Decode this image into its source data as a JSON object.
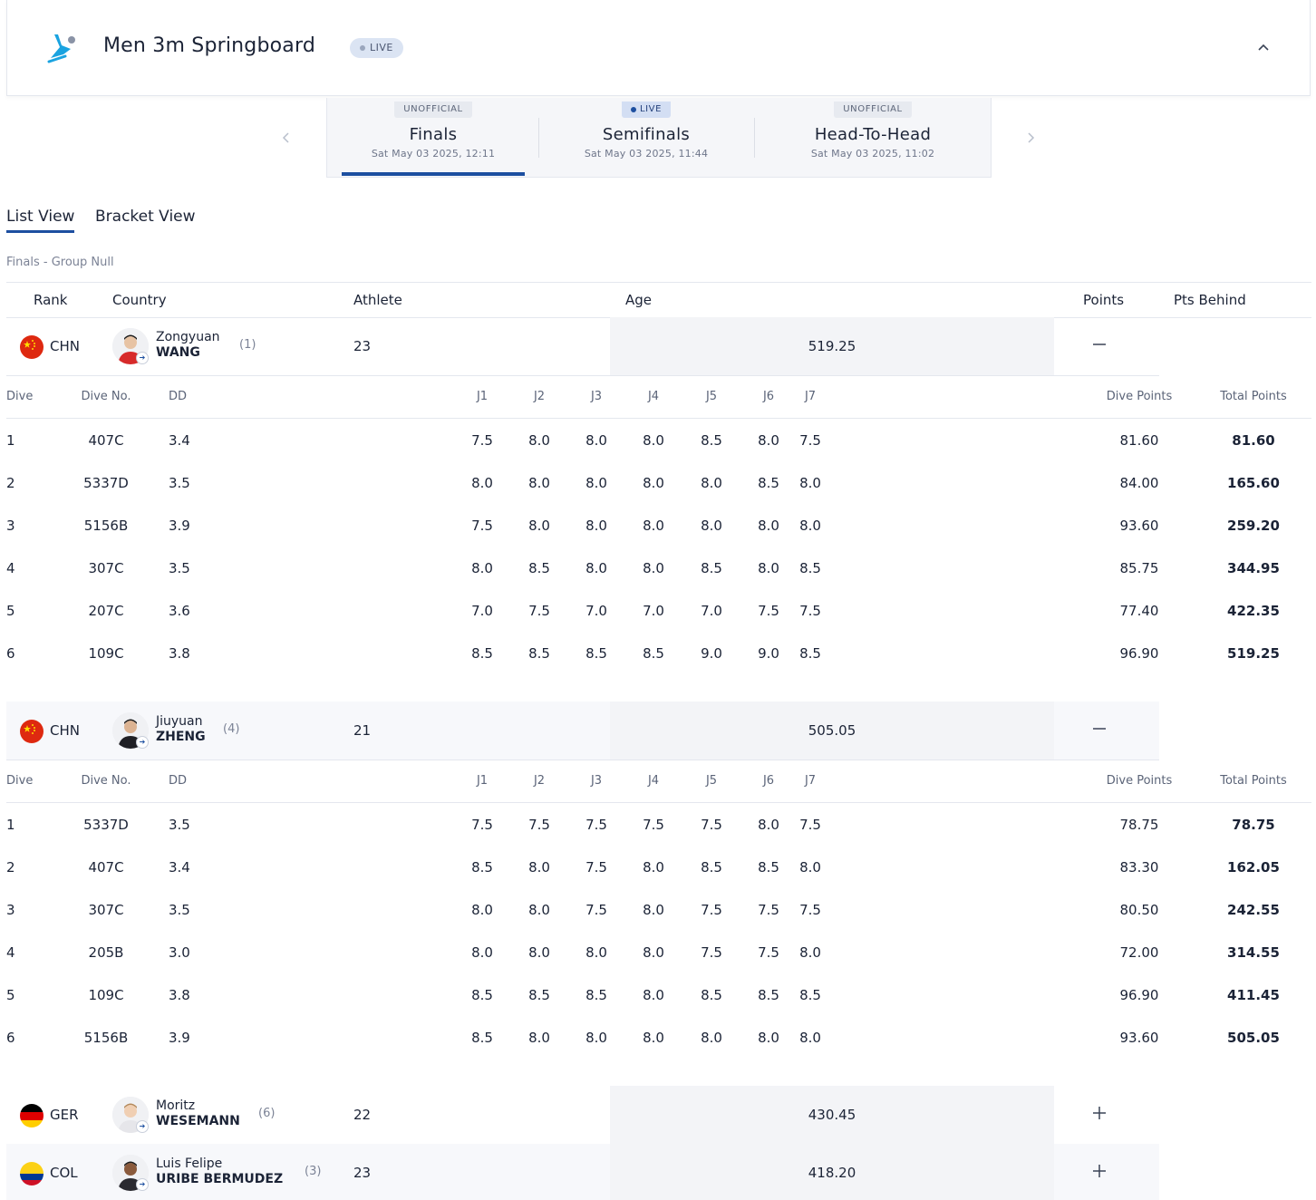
{
  "event": {
    "title": "Men 3m Springboard",
    "live_label": "LIVE"
  },
  "colors": {
    "accent": "#1d4fa0",
    "icon_blue": "#1aa3e0",
    "live_badge_bg": "#dbe4f3"
  },
  "phases": [
    {
      "status": "UNOFFICIAL",
      "name": "Finals",
      "date": "Sat May 03 2025, 12:11",
      "selected": true
    },
    {
      "status": "LIVE",
      "name": "Semifinals",
      "date": "Sat May 03 2025, 11:44",
      "selected": false
    },
    {
      "status": "UNOFFICIAL",
      "name": "Head-To-Head",
      "date": "Sat May 03 2025, 11:02",
      "selected": false
    }
  ],
  "view_tabs": {
    "list": "List View",
    "bracket": "Bracket View",
    "active": "list"
  },
  "group_label": "Finals - Group Null",
  "table_headers": {
    "rank": "Rank",
    "country": "Country",
    "athlete": "Athlete",
    "age": "Age",
    "points": "Points",
    "pts_behind": "Pts Behind"
  },
  "dive_headers": {
    "dive": "Dive",
    "dive_no": "Dive No.",
    "dd": "DD",
    "judges": [
      "J1",
      "J2",
      "J3",
      "J4",
      "J5",
      "J6",
      "J7"
    ],
    "dive_points": "Dive Points",
    "total_points": "Total Points"
  },
  "athletes": [
    {
      "noc": "CHN",
      "flag": "china-flag",
      "first": "Zongyuan",
      "last": "WANG",
      "seed": "(1)",
      "age": "23",
      "points": "519.25",
      "expanded": true,
      "dives": [
        {
          "dive": "1",
          "no": "407C",
          "dd": "3.4",
          "j": [
            "7.5",
            "8.0",
            "8.0",
            "8.0",
            "8.5",
            "8.0",
            "7.5"
          ],
          "dp": "81.60",
          "tp": "81.60"
        },
        {
          "dive": "2",
          "no": "5337D",
          "dd": "3.5",
          "j": [
            "8.0",
            "8.0",
            "8.0",
            "8.0",
            "8.0",
            "8.5",
            "8.0"
          ],
          "dp": "84.00",
          "tp": "165.60"
        },
        {
          "dive": "3",
          "no": "5156B",
          "dd": "3.9",
          "j": [
            "7.5",
            "8.0",
            "8.0",
            "8.0",
            "8.0",
            "8.0",
            "8.0"
          ],
          "dp": "93.60",
          "tp": "259.20"
        },
        {
          "dive": "4",
          "no": "307C",
          "dd": "3.5",
          "j": [
            "8.0",
            "8.5",
            "8.0",
            "8.0",
            "8.5",
            "8.0",
            "8.5"
          ],
          "dp": "85.75",
          "tp": "344.95"
        },
        {
          "dive": "5",
          "no": "207C",
          "dd": "3.6",
          "j": [
            "7.0",
            "7.5",
            "7.0",
            "7.0",
            "7.0",
            "7.5",
            "7.5"
          ],
          "dp": "77.40",
          "tp": "422.35"
        },
        {
          "dive": "6",
          "no": "109C",
          "dd": "3.8",
          "j": [
            "8.5",
            "8.5",
            "8.5",
            "8.5",
            "9.0",
            "9.0",
            "8.5"
          ],
          "dp": "96.90",
          "tp": "519.25"
        }
      ]
    },
    {
      "noc": "CHN",
      "flag": "china-flag",
      "first": "Jiuyuan",
      "last": "ZHENG",
      "seed": "(4)",
      "age": "21",
      "points": "505.05",
      "expanded": true,
      "dives": [
        {
          "dive": "1",
          "no": "5337D",
          "dd": "3.5",
          "j": [
            "7.5",
            "7.5",
            "7.5",
            "7.5",
            "7.5",
            "8.0",
            "7.5"
          ],
          "dp": "78.75",
          "tp": "78.75"
        },
        {
          "dive": "2",
          "no": "407C",
          "dd": "3.4",
          "j": [
            "8.5",
            "8.0",
            "7.5",
            "8.0",
            "8.5",
            "8.5",
            "8.0"
          ],
          "dp": "83.30",
          "tp": "162.05"
        },
        {
          "dive": "3",
          "no": "307C",
          "dd": "3.5",
          "j": [
            "8.0",
            "8.0",
            "7.5",
            "8.0",
            "7.5",
            "7.5",
            "7.5"
          ],
          "dp": "80.50",
          "tp": "242.55"
        },
        {
          "dive": "4",
          "no": "205B",
          "dd": "3.0",
          "j": [
            "8.0",
            "8.0",
            "8.0",
            "8.0",
            "7.5",
            "7.5",
            "8.0"
          ],
          "dp": "72.00",
          "tp": "314.55"
        },
        {
          "dive": "5",
          "no": "109C",
          "dd": "3.8",
          "j": [
            "8.5",
            "8.5",
            "8.5",
            "8.0",
            "8.5",
            "8.5",
            "8.5"
          ],
          "dp": "96.90",
          "tp": "411.45"
        },
        {
          "dive": "6",
          "no": "5156B",
          "dd": "3.9",
          "j": [
            "8.5",
            "8.0",
            "8.0",
            "8.0",
            "8.0",
            "8.0",
            "8.0"
          ],
          "dp": "93.60",
          "tp": "505.05"
        }
      ]
    },
    {
      "noc": "GER",
      "flag": "germany-flag",
      "first": "Moritz",
      "last": "WESEMANN",
      "seed": "(6)",
      "age": "22",
      "points": "430.45",
      "expanded": false
    },
    {
      "noc": "COL",
      "flag": "colombia-flag",
      "first": "Luis Felipe",
      "last": "URIBE BERMUDEZ",
      "seed": "(3)",
      "age": "23",
      "points": "418.20",
      "expanded": false
    }
  ]
}
